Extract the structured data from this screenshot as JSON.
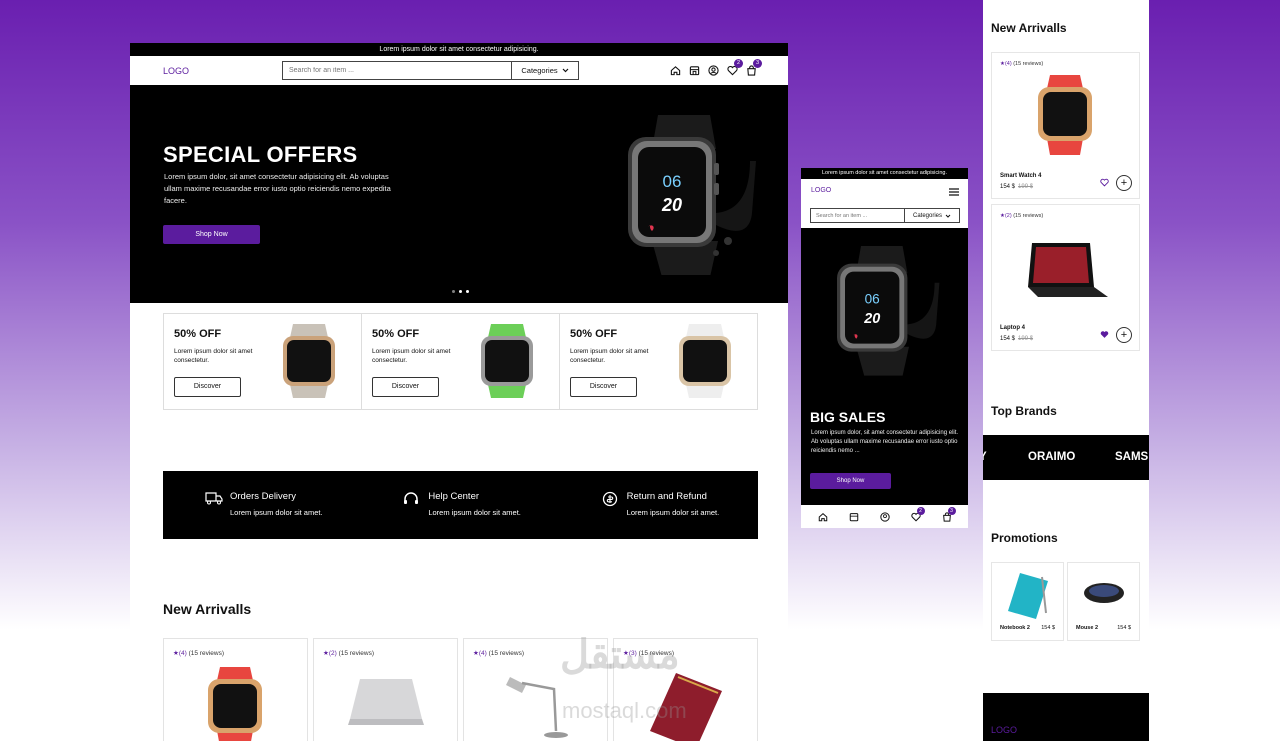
{
  "desktop": {
    "topbar": "Lorem ipsum dolor sit amet consectetur adipisicing.",
    "logo": "LOGO",
    "search_placeholder": "Search for an item ...",
    "categories": "Categories",
    "wishlist_count": "2",
    "cart_count": "3",
    "hero": {
      "title": "SPECIAL OFFERS",
      "text": "Lorem ipsum dolor, sit amet consectetur adipisicing elit. Ab voluptas ullam maxime recusandae error iusto optio reiciendis nemo expedita facere.",
      "button": "Shop Now",
      "watch_top": "06",
      "watch_bottom": "20"
    },
    "offers": [
      {
        "title": "50% OFF",
        "text": "Lorem ipsum dolor sit amet consectetur.",
        "button": "Discover"
      },
      {
        "title": "50% OFF",
        "text": "Lorem ipsum dolor sit amet consectetur.",
        "button": "Discover"
      },
      {
        "title": "50% OFF",
        "text": "Lorem ipsum dolor sit amet consectetur.",
        "button": "Discover"
      }
    ],
    "services": [
      {
        "title": "Orders Delivery",
        "text": "Lorem ipsum dolor sit amet."
      },
      {
        "title": "Help Center",
        "text": "Lorem ipsum dolor sit amet."
      },
      {
        "title": "Return and Refund",
        "text": "Lorem ipsum dolor sit amet."
      }
    ],
    "new_arrivals_title": "New Arrivalls",
    "products": [
      {
        "rating": "(4)",
        "reviews": "(15 reviews)"
      },
      {
        "rating": "(2)",
        "reviews": "(15 reviews)"
      },
      {
        "rating": "(4)",
        "reviews": "(15 reviews)"
      },
      {
        "rating": "(3)",
        "reviews": "(15 reviews)"
      }
    ]
  },
  "mobile": {
    "topbar": "Lorem ipsum dolor sit amet consectetur adipisicing.",
    "logo": "LOGO",
    "search_placeholder": "Search for an item ...",
    "categories": "Categories",
    "hero_title": "BIG SALES",
    "hero_text": "Lorem ipsum dolor, sit amet consectetur adipisicing elit. Ab voluptas ullam maxime recusandae error iusto optio reiciendis nemo ...",
    "button": "Shop Now",
    "watch_top": "06",
    "watch_bottom": "20",
    "wishlist_count": "2",
    "cart_count": "3"
  },
  "right": {
    "new_arrivals_title": "New Arrivalls",
    "items": [
      {
        "rating": "(4)",
        "reviews": "(15 reviews)",
        "name": "Smart Watch 4",
        "price": "154 $",
        "old_price": "199 $"
      },
      {
        "rating": "(2)",
        "reviews": "(15 reviews)",
        "name": "Laptop 4",
        "price": "154 $",
        "old_price": "199 $"
      }
    ],
    "top_brands_title": "Top Brands",
    "brands": [
      "Y",
      "ORAIMO",
      "SAMS"
    ],
    "promotions_title": "Promotions",
    "promos": [
      {
        "name": "Notebook 2",
        "price": "154 $"
      },
      {
        "name": "Mouse 2",
        "price": "154 $"
      }
    ],
    "footer_logo": "LOGO"
  },
  "watermark": {
    "arabic": "مستقل",
    "latin": "mostaql.com"
  },
  "colors": {
    "accent": "#5b1c9e",
    "dark": "#000000"
  }
}
